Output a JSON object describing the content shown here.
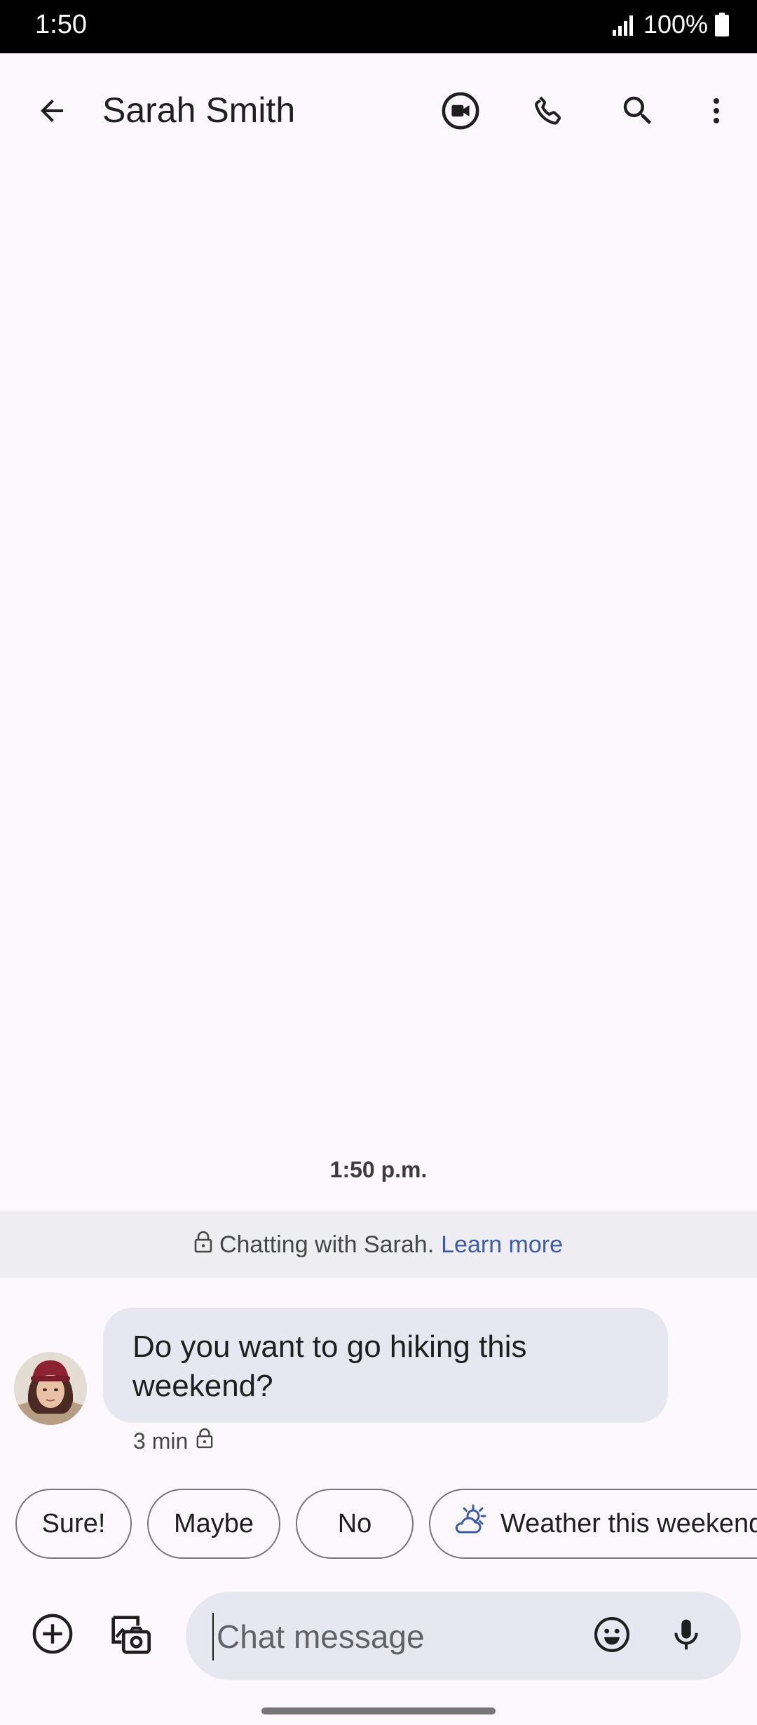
{
  "status_bar": {
    "time": "1:50",
    "battery": "100%"
  },
  "header": {
    "title": "Sarah Smith",
    "icons": [
      "back-arrow-icon",
      "video-call-icon",
      "phone-icon",
      "search-icon",
      "more-vert-icon"
    ]
  },
  "conversation": {
    "time_divider": "1:50  p.m.",
    "banner": {
      "text": "Chatting with Sarah.",
      "link": "Learn more"
    },
    "messages": [
      {
        "sender": "Sarah Smith",
        "text": "Do you want to go hiking this weekend?",
        "meta": "3 min"
      }
    ]
  },
  "suggestions": {
    "chips": [
      "Sure!",
      "Maybe",
      "No",
      "Weather this weekend"
    ]
  },
  "compose": {
    "placeholder": "Chat message",
    "value": ""
  },
  "colors": {
    "background": "#FDF8FD",
    "bubble": "#E6E7F0",
    "link": "#3E5BA9",
    "chip_border": "#79747E"
  }
}
